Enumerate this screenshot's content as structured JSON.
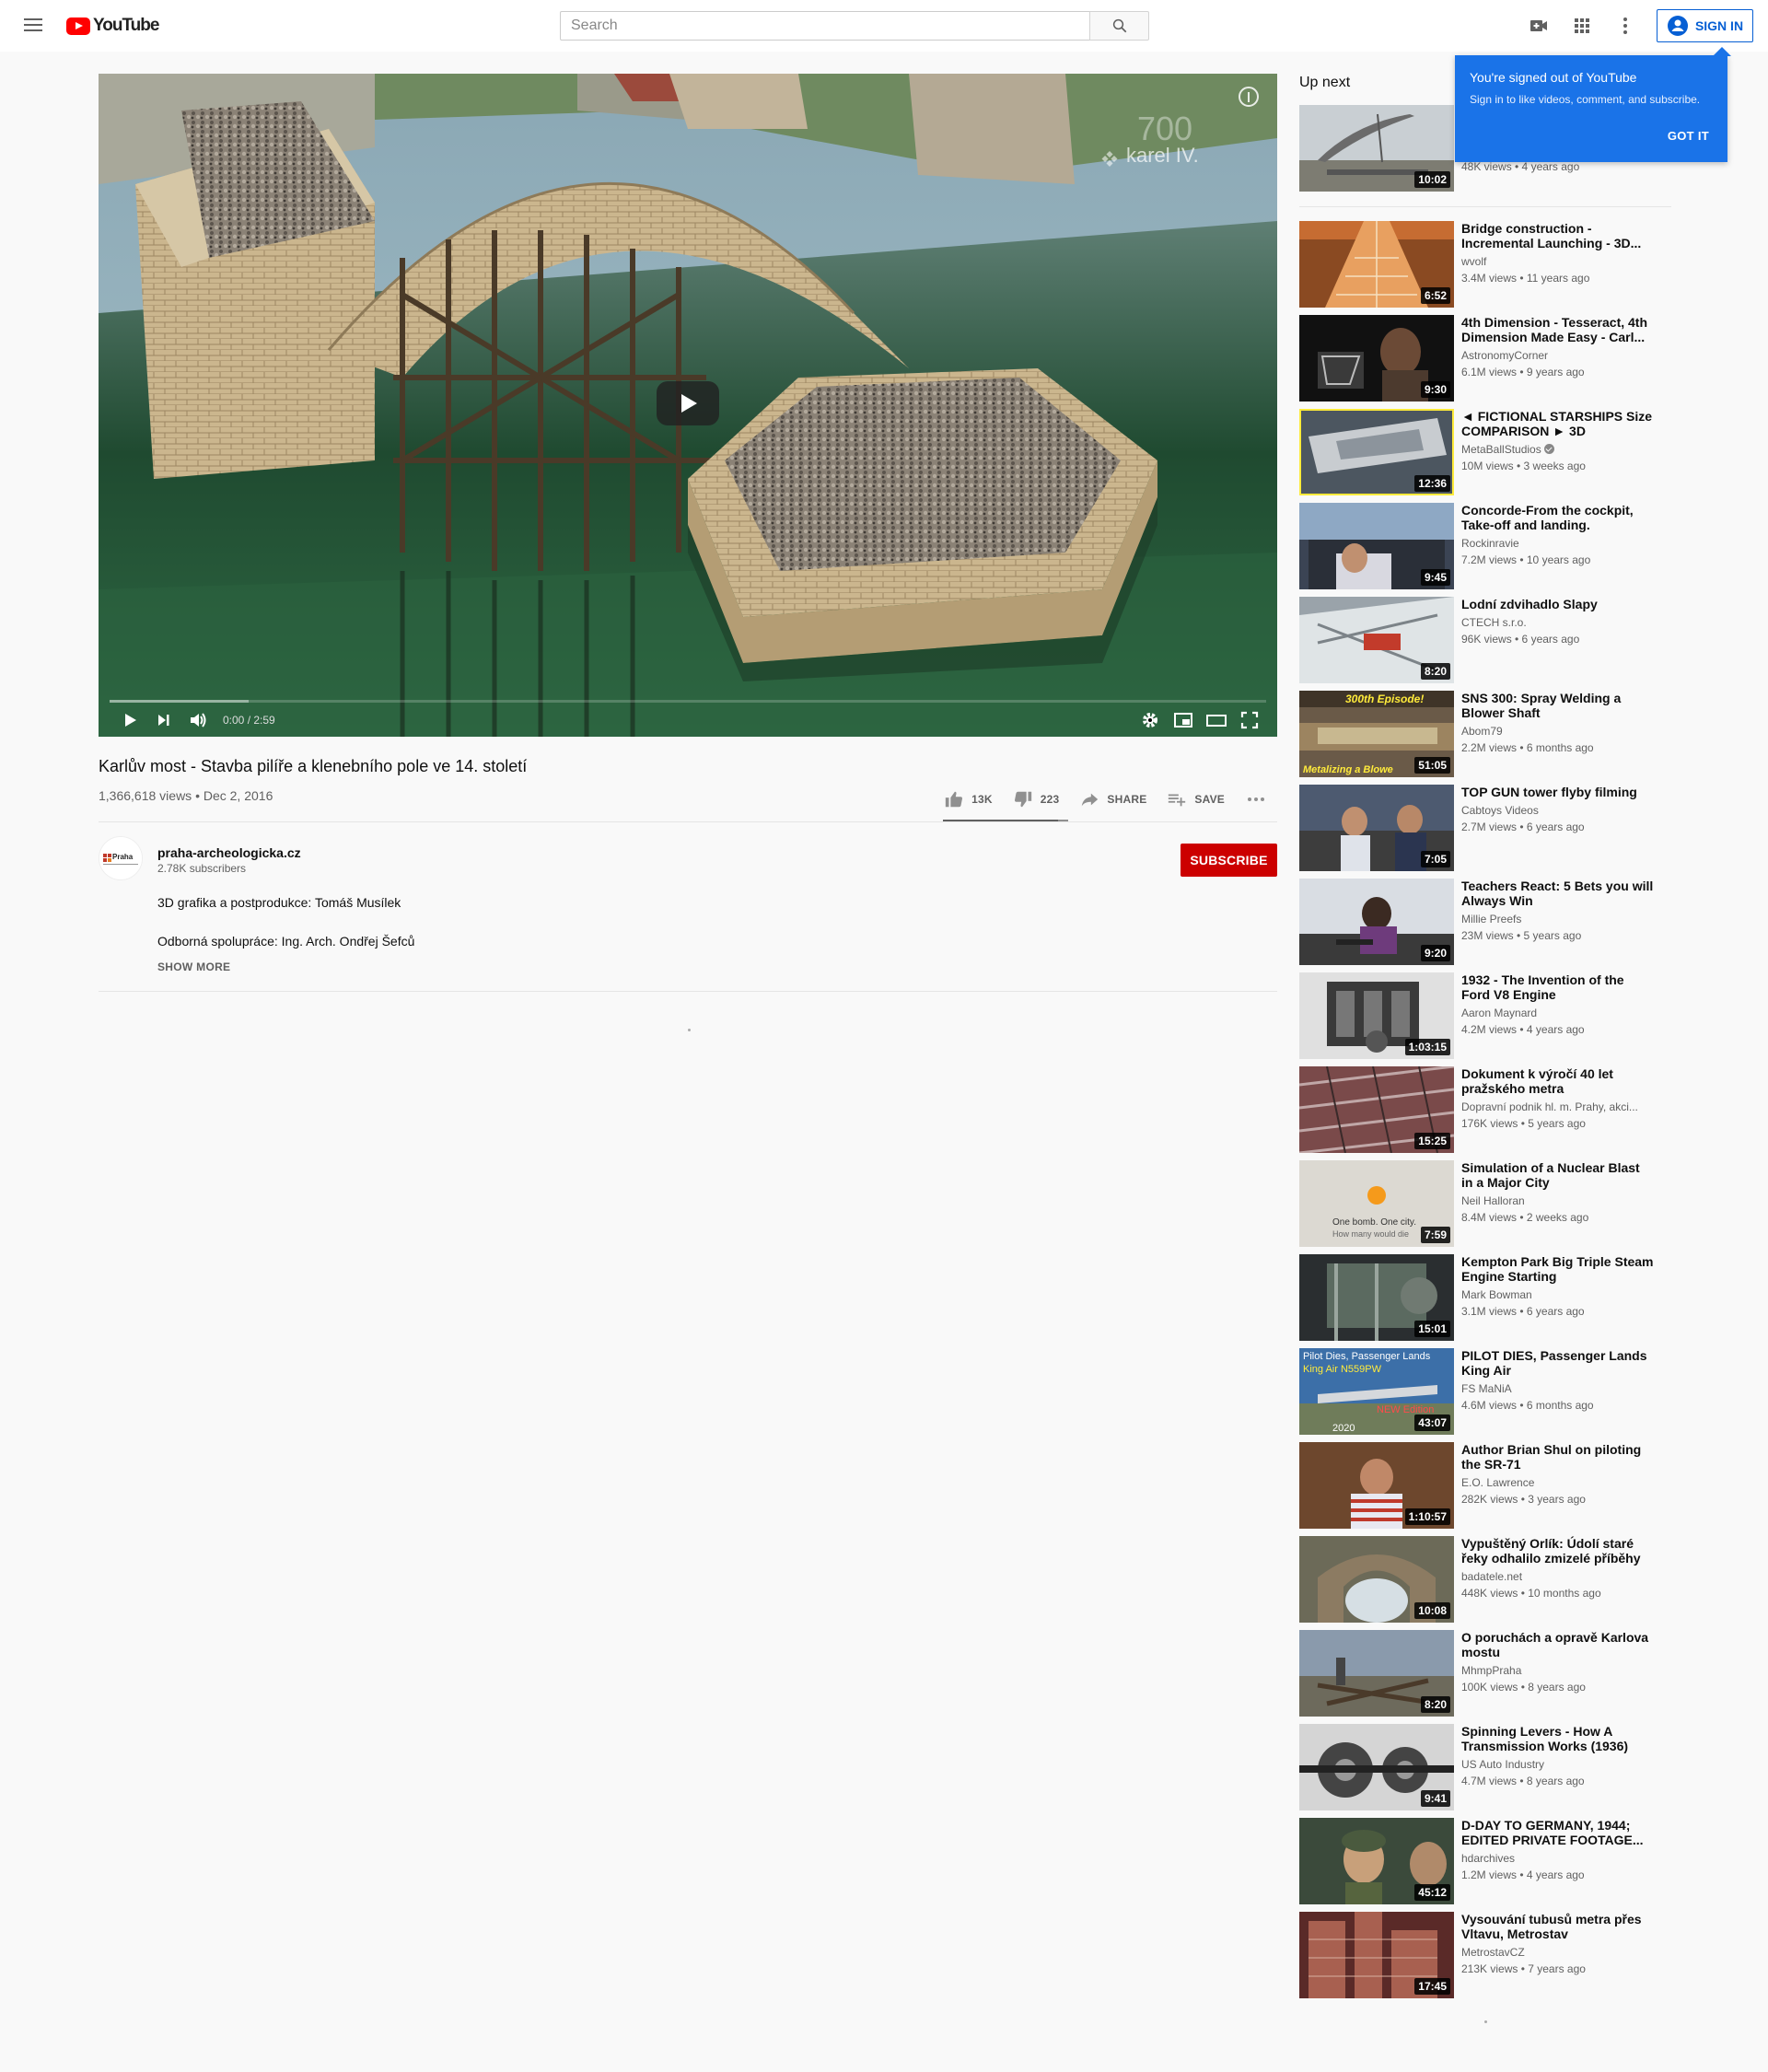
{
  "masthead": {
    "logo_text": "YouTube",
    "search_placeholder": "Search",
    "signin_label": "SIGN IN"
  },
  "player": {
    "time_display": "0:00 / 2:59",
    "watermark_text": "karel IV.",
    "watermark_number": "700",
    "loaded_fraction": 0.12
  },
  "video": {
    "title": "Karlův most - Stavba pilíře a klenebního pole ve 14. století",
    "views_date": "1,366,618 views • Dec 2, 2016",
    "likes": "13K",
    "dislikes": "223",
    "share_label": "SHARE",
    "save_label": "SAVE"
  },
  "channel": {
    "name": "praha-archeologicka.cz",
    "subscribers": "2.78K subscribers",
    "subscribe_label": "SUBSCRIBE",
    "avatar_text": "Praha"
  },
  "description": {
    "line1": "3D grafika a postprodukce: Tomáš Musílek",
    "line2": "Odborná spolupráce: Ing. Arch. Ondřej Šefců",
    "show_more": "SHOW MORE"
  },
  "tooltip": {
    "title": "You're signed out of YouTube",
    "body": "Sign in to like videos, comment, and subscribe.",
    "button": "GOT IT"
  },
  "sidebar": {
    "up_next_label": "Up next",
    "autoplay": {
      "views": "48K views • 4 years ago",
      "duration": "10:02"
    },
    "items": [
      {
        "title": "Bridge construction - Incremental Launching - 3D...",
        "channel": "wvolf",
        "views": "3.4M views • 11 years ago",
        "duration": "6:52"
      },
      {
        "title": "4th Dimension - Tesseract, 4th Dimension Made Easy - Carl...",
        "channel": "AstronomyCorner",
        "views": "6.1M views • 9 years ago",
        "duration": "9:30"
      },
      {
        "title": "◄ FICTIONAL STARSHIPS Size COMPARISON ► 3D",
        "channel": "MetaBallStudios",
        "views": "10M views • 3 weeks ago",
        "duration": "12:36",
        "verified": true
      },
      {
        "title": "Concorde-From the cockpit, Take-off and landing.",
        "channel": "Rockinravie",
        "views": "7.2M views • 10 years ago",
        "duration": "9:45"
      },
      {
        "title": "Lodní zdvihadlo Slapy",
        "channel": "CTECH s.r.o.",
        "views": "96K views • 6 years ago",
        "duration": "8:20"
      },
      {
        "title": "SNS 300: Spray Welding a Blower Shaft",
        "channel": "Abom79",
        "views": "2.2M views • 6 months ago",
        "duration": "51:05"
      },
      {
        "title": "TOP GUN tower flyby filming",
        "channel": "Cabtoys Videos",
        "views": "2.7M views • 6 years ago",
        "duration": "7:05"
      },
      {
        "title": "Teachers React: 5 Bets you will Always Win",
        "channel": "Millie Preefs",
        "views": "23M views • 5 years ago",
        "duration": "9:20"
      },
      {
        "title": "1932 - The Invention of the Ford V8 Engine",
        "channel": "Aaron Maynard",
        "views": "4.2M views • 4 years ago",
        "duration": "1:03:15"
      },
      {
        "title": "Dokument k výročí 40 let pražského metra",
        "channel": "Dopravní podnik hl. m. Prahy, akci...",
        "views": "176K views • 5 years ago",
        "duration": "15:25"
      },
      {
        "title": "Simulation of a Nuclear Blast in a Major City",
        "channel": "Neil Halloran",
        "views": "8.4M views • 2 weeks ago",
        "duration": "7:59"
      },
      {
        "title": "Kempton Park Big Triple Steam Engine Starting",
        "channel": "Mark Bowman",
        "views": "3.1M views • 6 years ago",
        "duration": "15:01"
      },
      {
        "title": "PILOT DIES, Passenger Lands King Air",
        "channel": "FS MaNiA",
        "views": "4.6M views • 6 months ago",
        "duration": "43:07"
      },
      {
        "title": "Author Brian Shul on piloting the SR-71",
        "channel": "E.O. Lawrence",
        "views": "282K views • 3 years ago",
        "duration": "1:10:57"
      },
      {
        "title": "Vypuštěný Orlík: Údolí staré řeky odhalilo zmizelé příběhy",
        "channel": "badatele.net",
        "views": "448K views • 10 months ago",
        "duration": "10:08"
      },
      {
        "title": "O poruchách a opravě Karlova mostu",
        "channel": "MhmpPraha",
        "views": "100K views • 8 years ago",
        "duration": "8:20"
      },
      {
        "title": "Spinning Levers - How A Transmission Works (1936)",
        "channel": "US Auto Industry",
        "views": "4.7M views • 8 years ago",
        "duration": "9:41"
      },
      {
        "title": "D-DAY TO GERMANY, 1944; EDITED PRIVATE FOOTAGE...",
        "channel": "hdarchives",
        "views": "1.2M views • 4 years ago",
        "duration": "45:12"
      },
      {
        "title": "Vysouvání tubusů metra přes Vltavu, Metrostav",
        "channel": "MetrostavCZ",
        "views": "213K views • 7 years ago",
        "duration": "17:45"
      }
    ]
  },
  "thumbnail_overlays": {
    "sns_top": "300th Episode!",
    "sns_bottom": "Metalizing a Blowe",
    "nuclear_line1": "One bomb. One city.",
    "nuclear_line2": "How many would die",
    "pilot_line1": "Pilot Dies, Passenger Lands",
    "pilot_line2": "King Air N559PW",
    "pilot_tag": "NEW Edition",
    "pilot_year": "2020"
  },
  "colors": {
    "brand_red": "#ff0000",
    "subscribe_red": "#cc0000",
    "link_blue": "#065fd4",
    "tooltip_blue": "#1a73e8"
  }
}
